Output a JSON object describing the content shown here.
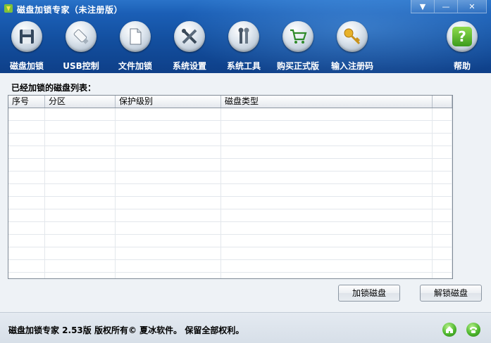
{
  "window": {
    "title": "磁盘加锁专家（未注册版）",
    "controls": [
      "▼",
      "—",
      "✕"
    ]
  },
  "toolbar": {
    "items": [
      {
        "label": "磁盘加锁",
        "icon": "floppy-disk-icon"
      },
      {
        "label": "USB控制",
        "icon": "usb-drive-icon"
      },
      {
        "label": "文件加锁",
        "icon": "document-icon"
      },
      {
        "label": "系统设置",
        "icon": "tools-icon"
      },
      {
        "label": "系统工具",
        "icon": "wrench-icon"
      },
      {
        "label": "购买正式版",
        "icon": "shopping-cart-icon"
      },
      {
        "label": "输入注册码",
        "icon": "key-icon"
      },
      {
        "label": "帮助",
        "icon": "help-icon"
      }
    ]
  },
  "main": {
    "list_caption": "已经加锁的磁盘列表：",
    "table": {
      "columns": [
        "序号",
        "分区",
        "保护级别",
        "磁盘类型",
        ""
      ],
      "rows": []
    },
    "buttons": {
      "lock": "加锁磁盘",
      "unlock": "解锁磁盘"
    }
  },
  "status": {
    "text": "磁盘加锁专家 2.53版  版权所有© 夏冰软件。 保留全部权利。",
    "icons": [
      "home-icon",
      "phone-icon"
    ]
  },
  "colors": {
    "header_top": "#2a73c9",
    "header_bottom": "#0e3f88",
    "body_bg": "#eef2f6"
  }
}
